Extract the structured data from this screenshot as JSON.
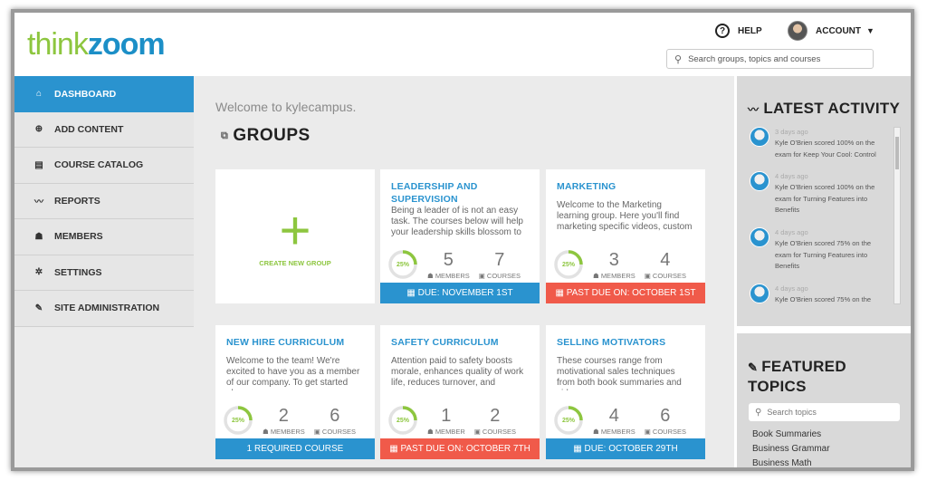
{
  "logo": {
    "part1": "think",
    "part2": "zoom"
  },
  "header": {
    "help_label": "HELP",
    "help_glyph": "?",
    "account_label": "ACCOUNT",
    "search_placeholder": "Search groups, topics and courses"
  },
  "sidebar": {
    "items": [
      {
        "label": "DASHBOARD",
        "icon": "home-icon",
        "glyph": "⌂",
        "active": true
      },
      {
        "label": "ADD CONTENT",
        "icon": "plus-circle-icon",
        "glyph": "⊕"
      },
      {
        "label": "COURSE CATALOG",
        "icon": "catalog-icon",
        "glyph": "▤"
      },
      {
        "label": "REPORTS",
        "icon": "chart-icon",
        "glyph": "〰"
      },
      {
        "label": "MEMBERS",
        "icon": "members-icon",
        "glyph": "☗"
      },
      {
        "label": "SETTINGS",
        "icon": "gear-icon",
        "glyph": "✲"
      },
      {
        "label": "SITE ADMINISTRATION",
        "icon": "wrench-icon",
        "glyph": "✎"
      }
    ]
  },
  "main": {
    "welcome": "Welcome to kylecampus.",
    "groups_title": "GROUPS",
    "create_group_label": "CREATE NEW GROUP",
    "groups": [
      {
        "title": "LEADERSHIP AND SUPERVISION",
        "desc": "Being a leader of is not an easy task. The courses below will help your leadership skills blossom to",
        "progress": "25%",
        "members": "5",
        "members_label": "MEMBERS",
        "courses": "7",
        "courses_label": "COURSES",
        "bar": "DUE: NOVEMBER 1ST",
        "bar_color": "#2a93cf"
      },
      {
        "title": "MARKETING",
        "desc": "Welcome to the Marketing learning group. Here you'll find marketing specific videos, custom company",
        "progress": "25%",
        "members": "3",
        "members_label": "MEMBERS",
        "courses": "4",
        "courses_label": "COURSES",
        "bar": "PAST DUE ON: OCTOBER 1ST",
        "bar_color": "#f05a4a"
      },
      {
        "title": "NEW HIRE CURRICULUM",
        "desc": "Welcome to the team! We're excited to have you as a member of our company. To get started please",
        "progress": "25%",
        "members": "2",
        "members_label": "MEMBERS",
        "courses": "6",
        "courses_label": "COURSES",
        "bar": "1 REQUIRED COURSE",
        "bar_color": "#2a93cf"
      },
      {
        "title": "SAFETY CURRICULUM",
        "desc": "Attention paid to safety boosts morale, enhances quality of work life, reduces turnover, and",
        "progress": "25%",
        "members": "1",
        "members_label": "MEMBER",
        "courses": "2",
        "courses_label": "COURSES",
        "bar": "PAST DUE ON: OCTOBER 7TH",
        "bar_color": "#f05a4a"
      },
      {
        "title": "SELLING MOTIVATORS",
        "desc": "These courses range from motivational sales techniques from both book summaries and videos.",
        "progress": "25%",
        "members": "4",
        "members_label": "MEMBERS",
        "courses": "6",
        "courses_label": "COURSES",
        "bar": "DUE: OCTOBER 29TH",
        "bar_color": "#2a93cf"
      }
    ]
  },
  "activity": {
    "title": "LATEST ACTIVITY",
    "items": [
      {
        "time": "3 days ago",
        "text1": "Kyle O'Brien scored 100% on the",
        "text2": "exam for Keep Your Cool: Control"
      },
      {
        "time": "4 days ago",
        "text1": "Kyle O'Brien scored 100% on the",
        "text2": "exam for Turning Features into",
        "text3": "Benefits"
      },
      {
        "time": "4 days ago",
        "text1": "Kyle O'Brien scored 75% on the",
        "text2": "exam for Turning Features into",
        "text3": "Benefits"
      },
      {
        "time": "4 days ago",
        "text1": "Kyle O'Brien scored 75% on the"
      }
    ]
  },
  "featured": {
    "title_line1": "FEATURED",
    "title_line2": "TOPICS",
    "search_placeholder": "Search topics",
    "topics": [
      "Book Summaries",
      "Business Grammar",
      "Business Math"
    ]
  }
}
